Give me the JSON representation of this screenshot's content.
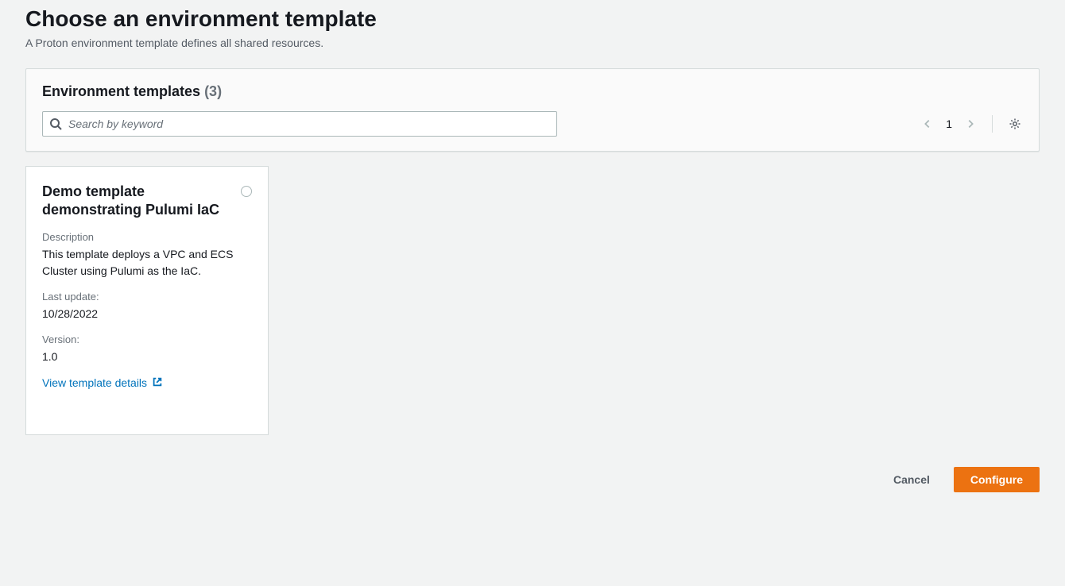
{
  "header": {
    "title": "Choose an environment template",
    "subtitle": "A Proton environment template defines all shared resources."
  },
  "panel": {
    "title": "Environment templates",
    "count": "(3)",
    "search_placeholder": "Search by keyword",
    "page": "1"
  },
  "card": {
    "title": "Demo template demonstrating Pulumi IaC",
    "description_label": "Description",
    "description": "This template deploys a VPC and ECS Cluster using Pulumi as the IaC.",
    "last_update_label": "Last update:",
    "last_update": "10/28/2022",
    "version_label": "Version:",
    "version": "1.0",
    "details_link": "View template details"
  },
  "footer": {
    "cancel": "Cancel",
    "configure": "Configure"
  }
}
